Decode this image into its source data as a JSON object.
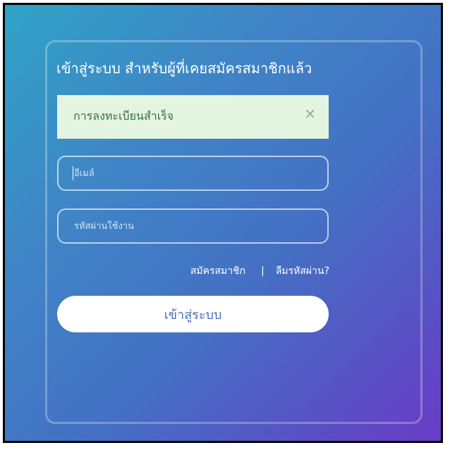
{
  "login": {
    "title": "เข้าสู่ระบบ สำหรับผู้ที่เคยสมัครสมาชิกแล้ว",
    "alert": {
      "message": "การลงทะเบียนสำเร็จ",
      "close_glyph": "×"
    },
    "email": {
      "placeholder": "อีเมล์",
      "value": ""
    },
    "password": {
      "placeholder": "รหัสผ่านใช้งาน",
      "value": ""
    },
    "links": {
      "register": "สมัครสมาชิก",
      "separator": "|",
      "forgot": "ลืมรหัสผ่าน?"
    },
    "submit_label": "เข้าสู่ระบบ"
  },
  "colors": {
    "gradient_start": "#2fa3c7",
    "gradient_end": "#6a3cc6",
    "alert_bg": "#e3f4e1",
    "alert_text": "#3b6e3f",
    "button_text": "#4a6fc0"
  }
}
